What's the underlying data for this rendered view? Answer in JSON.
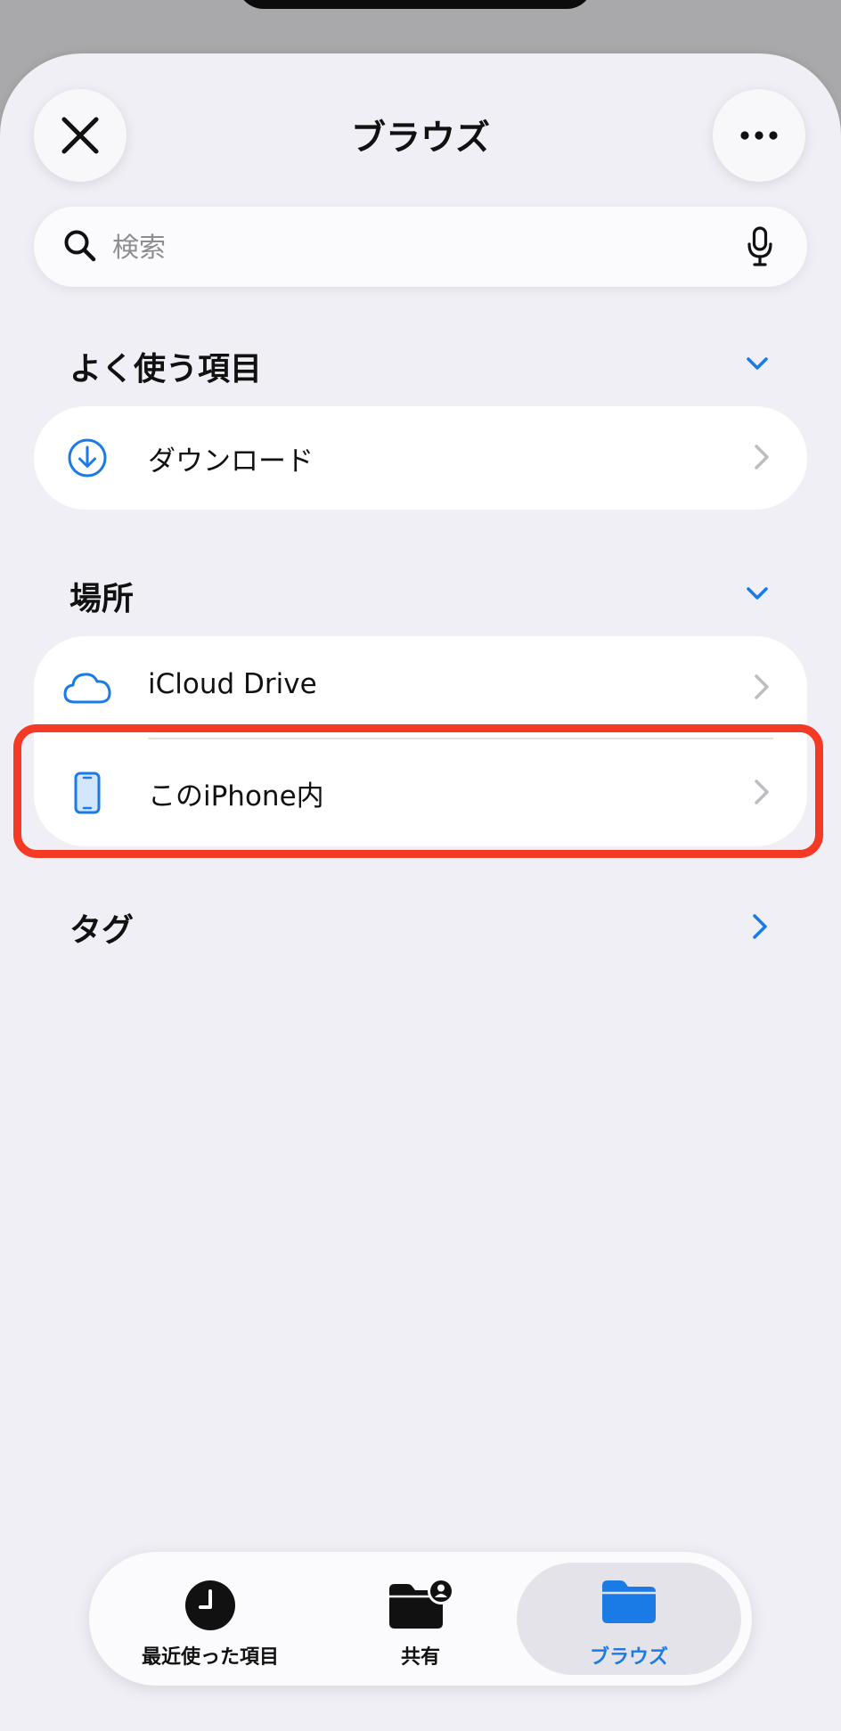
{
  "header": {
    "title": "ブラウズ",
    "close_icon": "close-icon",
    "more_icon": "ellipsis-icon"
  },
  "search": {
    "placeholder": "検索",
    "value": "",
    "search_icon": "magnifier-icon",
    "mic_icon": "microphone-icon"
  },
  "favorites": {
    "title": "よく使う項目",
    "expanded": true,
    "items": [
      {
        "label": "ダウンロード",
        "icon": "download-circle-icon"
      }
    ]
  },
  "locations": {
    "title": "場所",
    "expanded": true,
    "items": [
      {
        "label": "iCloud Drive",
        "icon": "cloud-icon"
      },
      {
        "label": "このiPhone内",
        "icon": "iphone-icon",
        "highlighted": true
      }
    ]
  },
  "tags": {
    "title": "タグ"
  },
  "tabbar": {
    "tabs": [
      {
        "label": "最近使った項目",
        "icon": "clock-icon",
        "active": false
      },
      {
        "label": "共有",
        "icon": "shared-folder-icon",
        "active": false
      },
      {
        "label": "ブラウズ",
        "icon": "folder-icon",
        "active": true
      }
    ]
  },
  "colors": {
    "accent": "#1a7be6",
    "highlight": "#f43a24",
    "background": "#f0eff5",
    "card": "#ffffff"
  }
}
